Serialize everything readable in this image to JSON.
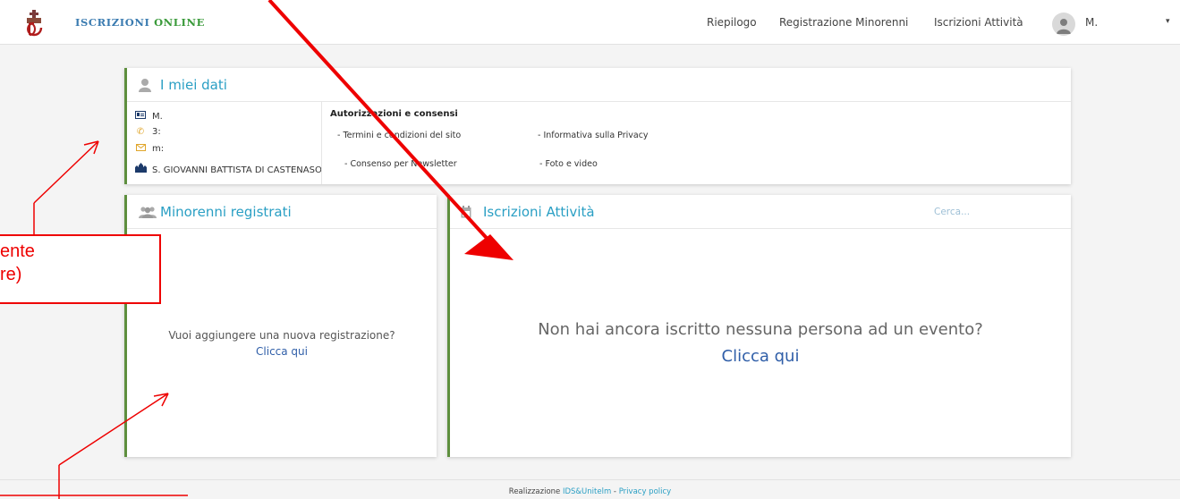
{
  "navbar": {
    "brand_part1": "ISCRIZIONI ",
    "brand_part2": "ONLINE",
    "links": [
      "Riepilogo",
      "Registrazione Minorenni",
      "Iscrizioni Attività"
    ],
    "user_name": "M.",
    "caret": "▾"
  },
  "my_data": {
    "title": "I miei dati",
    "name": "M.",
    "phone": "3:",
    "email": "m:",
    "parish": "S. GIOVANNI BATTISTA DI CASTENASO",
    "auth_title": "Autorizzazioni e consensi",
    "auth_items": [
      "- Termini e condizioni del sito",
      "- Informativa sulla Privacy",
      "- Consenso per Newsletter",
      "- Foto e video"
    ]
  },
  "minors": {
    "title": "Minorenni registrati",
    "question": "Vuoi aggiungere una nuova registrazione?",
    "link": "Clicca qui"
  },
  "activities": {
    "title": "Iscrizioni Attività",
    "search": "Cerca...",
    "question": "Non hai ancora iscritto nessuna persona ad un evento?",
    "link": "Clicca qui"
  },
  "footer": {
    "prefix": "Realizzazione ",
    "company": "IDS&Unitelm",
    "separator": " - ",
    "privacy": "Privacy policy"
  },
  "annotation": {
    "line1": "ente",
    "line2": "re)"
  },
  "colors": {
    "accent_green": "#5e8f3e",
    "title_blue": "#2a9fc4",
    "link_blue": "#2f5ea8",
    "annotation_red": "#ee0000"
  }
}
